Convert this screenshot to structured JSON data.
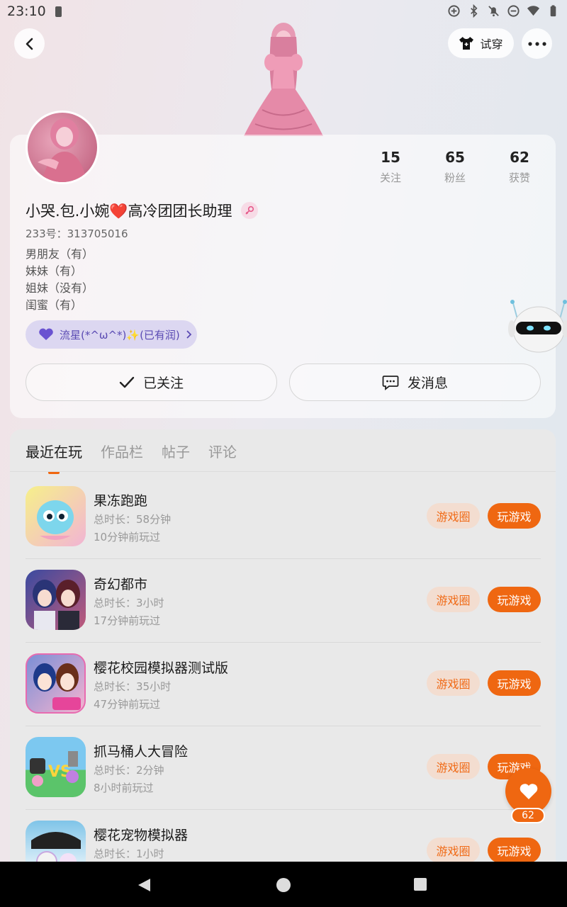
{
  "status_bar": {
    "time": "23:10"
  },
  "header": {
    "try_on_label": "试穿"
  },
  "profile": {
    "stats": [
      {
        "value": "15",
        "label": "关注"
      },
      {
        "value": "65",
        "label": "粉丝"
      },
      {
        "value": "62",
        "label": "获赞"
      }
    ],
    "username": "小哭.包.小婉❤️高冷团团长助理",
    "uid": "233号：313705016",
    "bio_lines": [
      "男朋友（有）",
      "妹妹（有）",
      "姐妹（没有）",
      "闺蜜（有）"
    ],
    "badge_text": "流星(*^ω^*)✨(已有润)",
    "follow_button": "已关注",
    "message_button": "发消息"
  },
  "tabs": [
    {
      "label": "最近在玩",
      "active": true
    },
    {
      "label": "作品栏",
      "active": false
    },
    {
      "label": "帖子",
      "active": false
    },
    {
      "label": "评论",
      "active": false
    }
  ],
  "games": [
    {
      "title": "果冻跑跑",
      "duration": "总时长：58分钟",
      "last_played": "10分钟前玩过",
      "circle_label": "游戏圈",
      "play_label": "玩游戏"
    },
    {
      "title": "奇幻都市",
      "duration": "总时长：3小时",
      "last_played": "17分钟前玩过",
      "circle_label": "游戏圈",
      "play_label": "玩游戏"
    },
    {
      "title": "樱花校园模拟器测试版",
      "duration": "总时长：35小时",
      "last_played": "47分钟前玩过",
      "circle_label": "游戏圈",
      "play_label": "玩游戏"
    },
    {
      "title": "抓马桶人大冒险",
      "duration": "总时长：2分钟",
      "last_played": "8小时前玩过",
      "circle_label": "游戏圈",
      "play_label": "玩游戏"
    },
    {
      "title": "樱花宠物模拟器",
      "duration": "总时长：1小时",
      "last_played": "",
      "circle_label": "游戏圈",
      "play_label": "玩游戏"
    }
  ],
  "like_fab": {
    "count": "62"
  },
  "colors": {
    "accent": "#ef6711",
    "accent_soft": "#f3ddd0",
    "badge_bg": "#dcd7f1",
    "badge_text": "#5a4ab3"
  }
}
